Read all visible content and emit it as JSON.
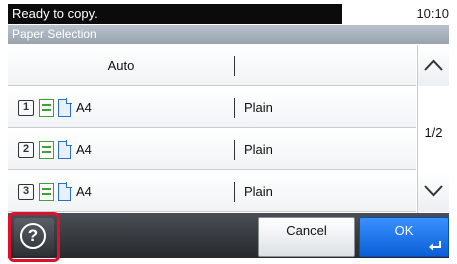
{
  "status": {
    "message": "Ready to copy.",
    "time": "10:10"
  },
  "title": "Paper Selection",
  "rows": [
    {
      "label": "Auto",
      "value": ""
    },
    {
      "drawer": "1",
      "size": "A4",
      "type": "Plain"
    },
    {
      "drawer": "2",
      "size": "A4",
      "type": "Plain"
    },
    {
      "drawer": "3",
      "size": "A4",
      "type": "Plain"
    }
  ],
  "pagination": {
    "page": "1/2"
  },
  "footer": {
    "help_label": "?",
    "cancel_label": "Cancel",
    "ok_label": "OK"
  },
  "colors": {
    "help_highlight": "#e0102a",
    "ok_blue": "#1a73e8",
    "status_bg": "#0b0b0b"
  },
  "icons": {
    "scroll_up": "chevron-up-icon",
    "scroll_down": "chevron-down-icon",
    "help": "help-icon",
    "enter": "enter-icon"
  }
}
